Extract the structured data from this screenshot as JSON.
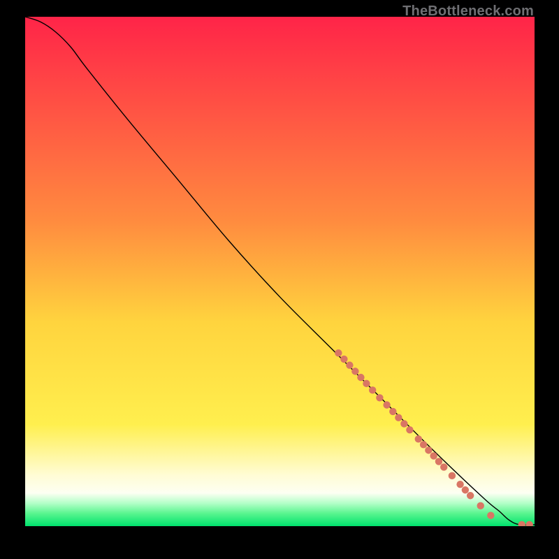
{
  "watermark": {
    "text": "TheBottleneck.com"
  },
  "chart_data": {
    "type": "line",
    "title": "",
    "xlabel": "",
    "ylabel": "",
    "xlim": [
      0,
      100
    ],
    "ylim": [
      0,
      100
    ],
    "grid": false,
    "gradient_stops": [
      {
        "offset": 0,
        "color": "#ff2448"
      },
      {
        "offset": 0.4,
        "color": "#ff8b3f"
      },
      {
        "offset": 0.6,
        "color": "#ffd43e"
      },
      {
        "offset": 0.8,
        "color": "#ffef4e"
      },
      {
        "offset": 0.9,
        "color": "#fffcd5"
      },
      {
        "offset": 0.935,
        "color": "#fdfff2"
      },
      {
        "offset": 0.955,
        "color": "#b3ffc8"
      },
      {
        "offset": 0.975,
        "color": "#59f58f"
      },
      {
        "offset": 1.0,
        "color": "#00e26d"
      }
    ],
    "series": [
      {
        "name": "curve",
        "type": "line",
        "color": "#000000",
        "width": 1.4,
        "points": [
          {
            "x": 0,
            "y": 100
          },
          {
            "x": 3,
            "y": 99
          },
          {
            "x": 6,
            "y": 97
          },
          {
            "x": 9,
            "y": 94
          },
          {
            "x": 12,
            "y": 90
          },
          {
            "x": 20,
            "y": 80
          },
          {
            "x": 30,
            "y": 68
          },
          {
            "x": 40,
            "y": 56
          },
          {
            "x": 50,
            "y": 45
          },
          {
            "x": 60,
            "y": 35
          },
          {
            "x": 70,
            "y": 25
          },
          {
            "x": 80,
            "y": 15
          },
          {
            "x": 90,
            "y": 5.5
          },
          {
            "x": 93,
            "y": 3
          },
          {
            "x": 95,
            "y": 1.2
          },
          {
            "x": 97,
            "y": 0.3
          },
          {
            "x": 100,
            "y": 0.3
          }
        ]
      },
      {
        "name": "dot-cluster",
        "type": "scatter",
        "color": "#d97664",
        "radius": 5.2,
        "points": [
          {
            "x": 61.5,
            "y": 34.0
          },
          {
            "x": 62.6,
            "y": 32.8
          },
          {
            "x": 63.7,
            "y": 31.6
          },
          {
            "x": 64.8,
            "y": 30.4
          },
          {
            "x": 65.9,
            "y": 29.2
          },
          {
            "x": 67.0,
            "y": 28.0
          },
          {
            "x": 68.2,
            "y": 26.7
          },
          {
            "x": 69.6,
            "y": 25.2
          },
          {
            "x": 71.0,
            "y": 23.8
          },
          {
            "x": 72.2,
            "y": 22.5
          },
          {
            "x": 73.3,
            "y": 21.3
          },
          {
            "x": 74.4,
            "y": 20.1
          },
          {
            "x": 75.5,
            "y": 18.9
          },
          {
            "x": 77.2,
            "y": 17.1
          },
          {
            "x": 78.2,
            "y": 16.0
          },
          {
            "x": 79.2,
            "y": 14.9
          },
          {
            "x": 80.2,
            "y": 13.8
          },
          {
            "x": 81.2,
            "y": 12.7
          },
          {
            "x": 82.2,
            "y": 11.6
          },
          {
            "x": 83.8,
            "y": 9.9
          },
          {
            "x": 85.4,
            "y": 8.2
          },
          {
            "x": 86.4,
            "y": 7.1
          },
          {
            "x": 87.4,
            "y": 6.0
          },
          {
            "x": 89.4,
            "y": 4.0
          },
          {
            "x": 91.4,
            "y": 2.1
          },
          {
            "x": 97.5,
            "y": 0.3
          },
          {
            "x": 99.0,
            "y": 0.3
          }
        ]
      }
    ]
  }
}
